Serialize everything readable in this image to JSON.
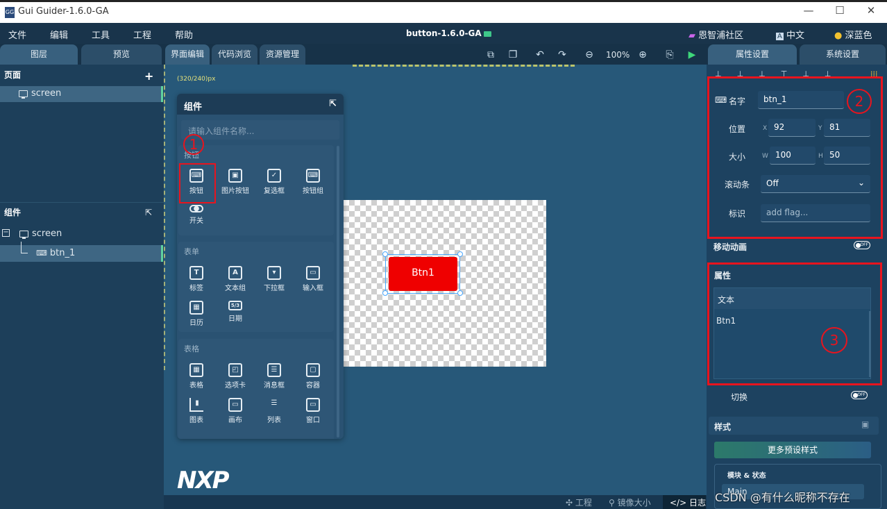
{
  "window": {
    "title": "Gui Guider-1.6.0-GA",
    "minimize": "—",
    "maximize": "☐",
    "close": "✕"
  },
  "menu": {
    "items": [
      "文件",
      "编辑",
      "工具",
      "工程",
      "帮助"
    ],
    "project": "button-1.6.0-GA",
    "community": "恩智浦社区",
    "language": "中文",
    "theme": "深蓝色"
  },
  "tabs": {
    "left": [
      "图层",
      "预览"
    ],
    "center": [
      "界面编辑",
      "代码浏览",
      "资源管理"
    ],
    "right": [
      "属性设置",
      "系统设置"
    ]
  },
  "toolbar": {
    "zoom": "100%"
  },
  "pages": {
    "header": "页面",
    "add": "+",
    "items": [
      "screen"
    ]
  },
  "widgets_tree": {
    "header": "组件",
    "root": "screen",
    "child": "btn_1",
    "collapse": "−"
  },
  "canvas": {
    "size_label": "(320/240)px",
    "button_text": "Btn1"
  },
  "components": {
    "title": "组件",
    "search_placeholder": "请输入组件名称...",
    "groups": [
      {
        "name": "按钮",
        "items": [
          "按钮",
          "图片按钮",
          "复选框",
          "按钮组",
          "开关"
        ]
      },
      {
        "name": "表单",
        "items": [
          "标签",
          "文本组",
          "下拉框",
          "输入框",
          "日历",
          "日期"
        ]
      },
      {
        "name": "表格",
        "items": [
          "表格",
          "选项卡",
          "消息框",
          "容器",
          "图表",
          "画布",
          "列表",
          "窗口"
        ]
      }
    ]
  },
  "props": {
    "name_label": "名字",
    "name_value": "btn_1",
    "pos_label": "位置",
    "x_label": "X",
    "x_value": "92",
    "y_label": "Y",
    "y_value": "81",
    "size_label": "大小",
    "w_label": "W",
    "w_value": "100",
    "h_label": "H",
    "h_value": "50",
    "scroll_label": "滚动条",
    "scroll_value": "Off",
    "flag_label": "标识",
    "flag_placeholder": "add flag...",
    "move_anim": "移动动画",
    "attr_header": "属性",
    "text_header": "文本",
    "text_value": "Btn1",
    "toggle_label": "切换",
    "toggle_state": "OFF",
    "style_header": "样式",
    "more_styles": "更多预设样式",
    "part_state": "模块 & 状态",
    "part_value": "Main"
  },
  "annotations": {
    "one": "1",
    "two": "2",
    "three": "3"
  },
  "status": {
    "project": "工程",
    "mirror": "镜像大小",
    "log": "日志"
  },
  "watermark": "CSDN @有什么昵称不存在",
  "brand": "NXP"
}
